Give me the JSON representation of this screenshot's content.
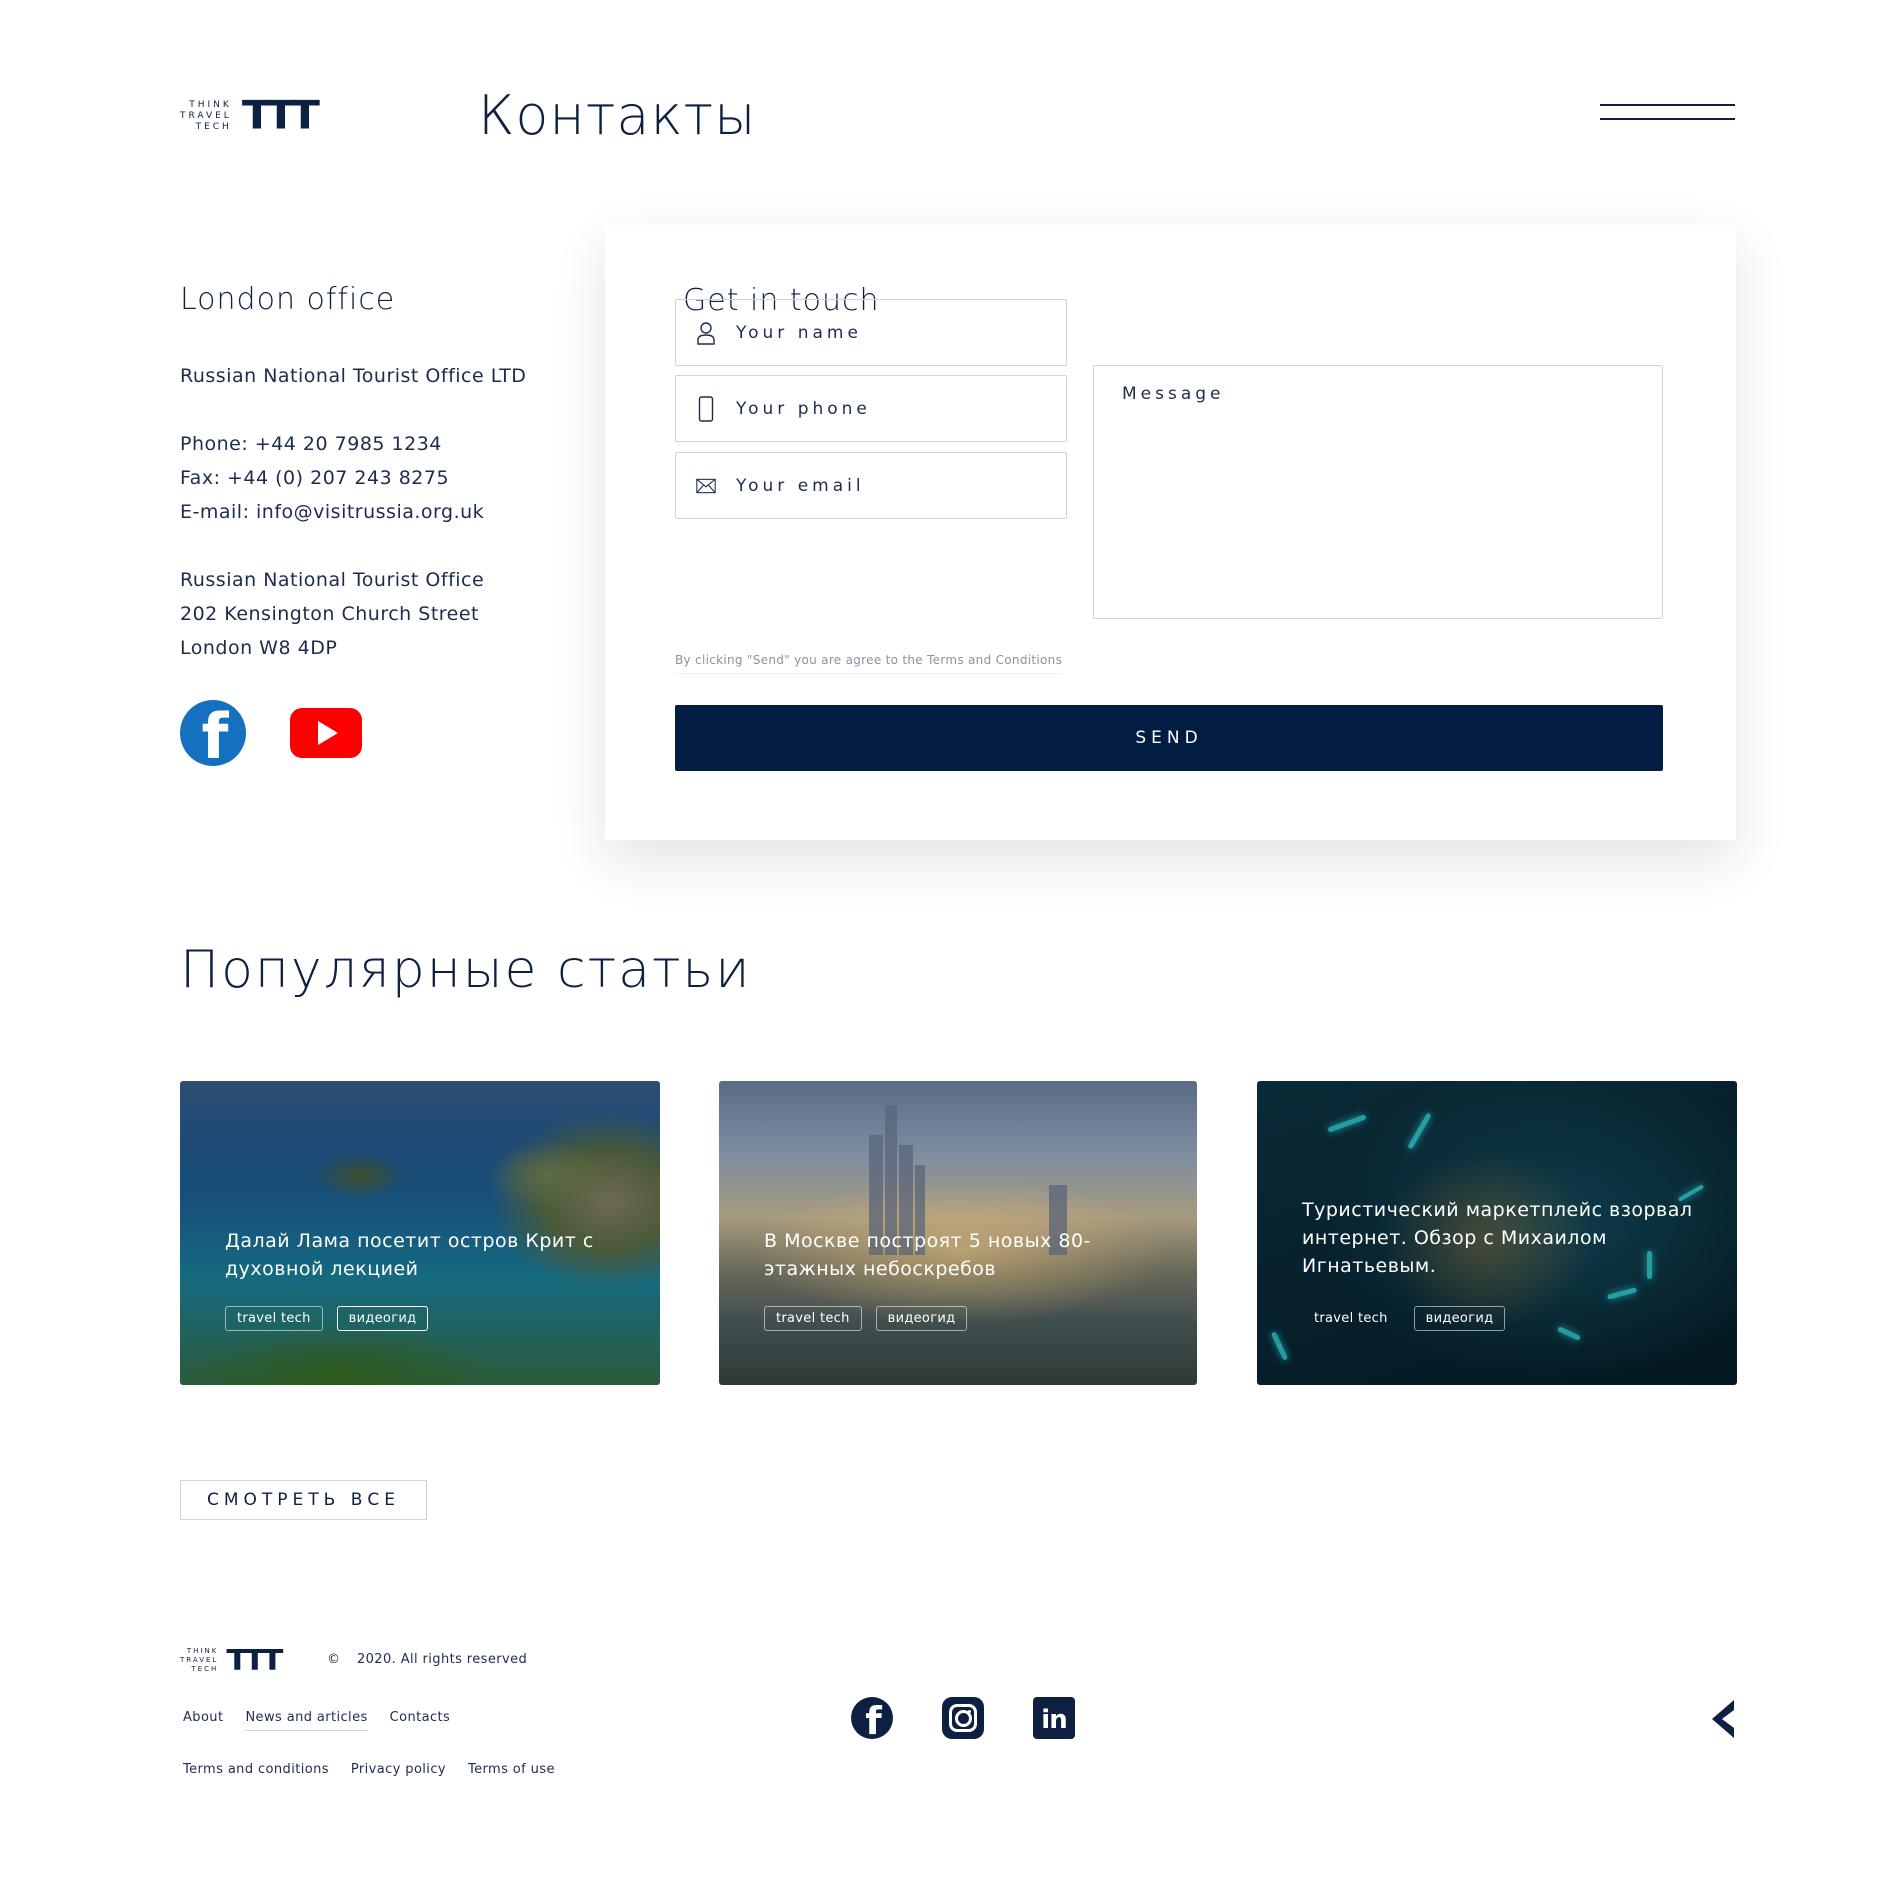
{
  "header": {
    "logo_small_lines": [
      "THINK",
      "TRAVEL",
      "TECH"
    ],
    "logo_big": "TTT",
    "title": "Контакты",
    "menu_icon": "hamburger-icon"
  },
  "office": {
    "heading": "London office",
    "company": "Russian National Tourist Office LTD",
    "phone": "Phone: +44 20 7985 1234",
    "fax": "Fax: +44 (0) 207 243 8275",
    "email": "E-mail: info@visitrussia.org.uk",
    "address_lines": [
      "Russian National Tourist Office",
      "202 Kensington Church Street",
      "London W8 4DP"
    ],
    "socials": [
      "facebook-icon",
      "youtube-icon"
    ]
  },
  "form": {
    "heading": "Get in touch",
    "name_placeholder": "Your name",
    "phone_placeholder": "Your phone",
    "email_placeholder": "Your email",
    "message_placeholder": "Message",
    "terms_note": "By clicking \"Send\" you are agree to the Terms and Conditions",
    "send_label": "SEND",
    "icons": [
      "user-icon",
      "phone-icon",
      "mail-icon"
    ]
  },
  "articles": {
    "heading": "Популярные статьи",
    "items": [
      {
        "title": "Далай Лама посетит остров Крит с духовной лекцией",
        "tags": [
          "travel tech",
          "видеогид"
        ]
      },
      {
        "title": "В Москве построят 5 новых 80-этажных небоскребов",
        "tags": [
          "travel tech",
          "видеогид"
        ]
      },
      {
        "title": "Туристический маркетплейс взорвал интернет. Обзор с Михаилом Игнатьевым.",
        "tags": [
          "travel tech",
          "видеогид"
        ]
      }
    ],
    "view_all": "СМОТРЕТЬ ВСЕ"
  },
  "footer": {
    "copyright_symbol": "©",
    "copyright": "2020. All rights reserved",
    "nav_top": [
      "About",
      "News and articles",
      "Contacts"
    ],
    "nav_bottom": [
      "Terms and conditions",
      "Privacy policy",
      "Terms of use"
    ],
    "socials": [
      "facebook-icon",
      "instagram-icon",
      "linkedin-icon"
    ],
    "back_icon": "chevron-left-icon"
  },
  "colors": {
    "brand_navy": "#031d42",
    "text": "#0e2042",
    "facebook": "#1570bf",
    "youtube": "#ff0000"
  }
}
